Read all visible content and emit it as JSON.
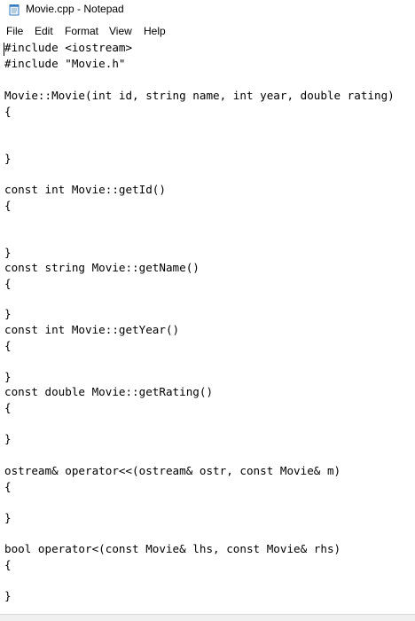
{
  "window": {
    "title": "Movie.cpp - Notepad",
    "icon": "notepad-icon"
  },
  "menu": {
    "items": [
      "File",
      "Edit",
      "Format",
      "View",
      "Help"
    ]
  },
  "editor": {
    "lines": [
      "#include <iostream>",
      "#include \"Movie.h\"",
      "",
      "Movie::Movie(int id, string name, int year, double rating)",
      "{",
      "",
      "",
      "}",
      "",
      "const int Movie::getId()",
      "{",
      "",
      "",
      "}",
      "const string Movie::getName()",
      "{",
      "",
      "}",
      "const int Movie::getYear()",
      "{",
      "",
      "}",
      "const double Movie::getRating()",
      "{",
      "",
      "}",
      "",
      "ostream& operator<<(ostream& ostr, const Movie& m)",
      "{",
      "",
      "}",
      "",
      "bool operator<(const Movie& lhs, const Movie& rhs)",
      "{",
      "",
      "}"
    ]
  }
}
